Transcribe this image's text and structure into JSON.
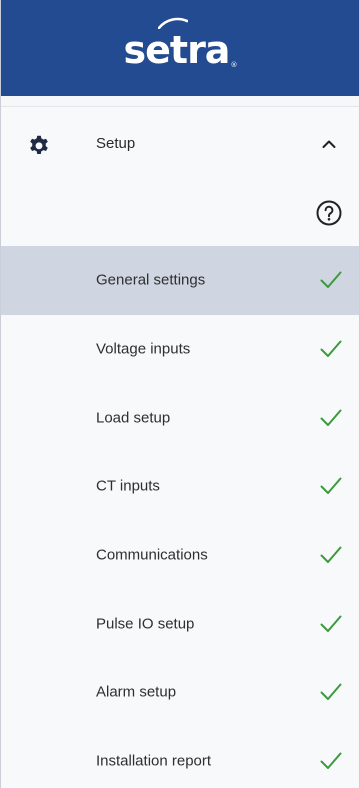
{
  "header": {
    "logo_text": "setra",
    "logo_mark": "®",
    "background_color": "#234b91"
  },
  "section": {
    "label": "Setup",
    "icon": "gear-icon",
    "expand_icon": "chevron-up-icon",
    "help_icon": "help-circle-icon"
  },
  "menu": {
    "active_background": "#cfd5e1",
    "check_color": "#3c9a3c",
    "items": [
      {
        "label": "General settings",
        "status_icon": "checkmark-icon",
        "active": true
      },
      {
        "label": "Voltage inputs",
        "status_icon": "checkmark-icon",
        "active": false
      },
      {
        "label": "Load setup",
        "status_icon": "checkmark-icon",
        "active": false
      },
      {
        "label": "CT inputs",
        "status_icon": "checkmark-icon",
        "active": false
      },
      {
        "label": "Communications",
        "status_icon": "checkmark-icon",
        "active": false
      },
      {
        "label": "Pulse IO setup",
        "status_icon": "checkmark-icon",
        "active": false
      },
      {
        "label": "Alarm setup",
        "status_icon": "checkmark-icon",
        "active": false
      },
      {
        "label": "Installation report",
        "status_icon": "checkmark-icon",
        "active": false
      }
    ]
  }
}
